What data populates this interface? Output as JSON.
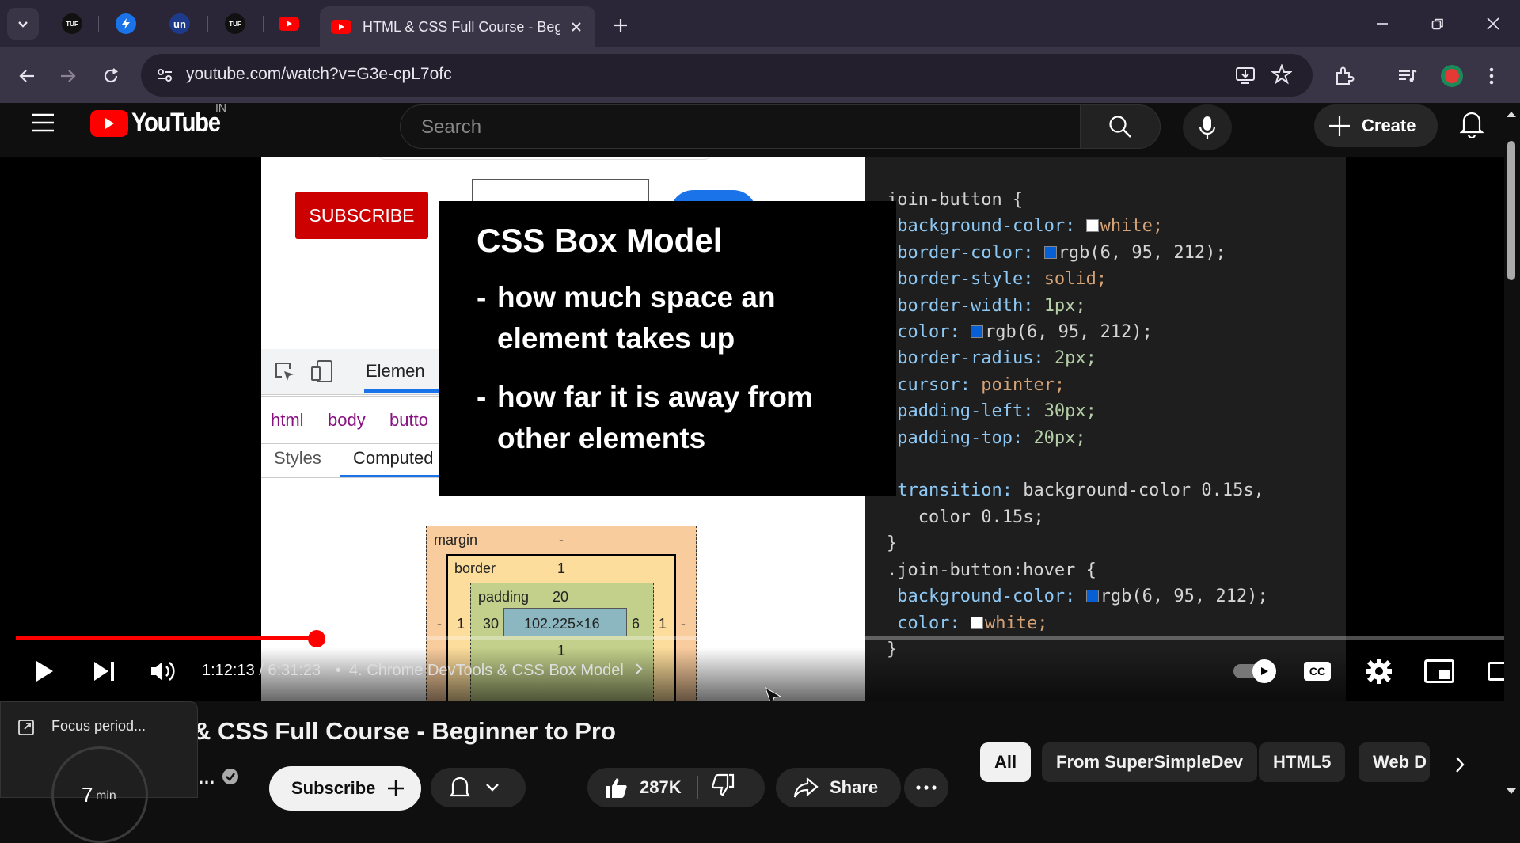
{
  "browser": {
    "tabs": [
      {
        "label": "TUF",
        "icon": "tuf-favicon"
      },
      {
        "label": "",
        "icon": "blue-bolt-favicon"
      },
      {
        "label": "un",
        "icon": "un-favicon"
      },
      {
        "label": "TUF",
        "icon": "tuf-favicon"
      },
      {
        "label": "",
        "icon": "youtube-favicon"
      }
    ],
    "active_tab_title": "HTML & CSS Full Course - Beginner to Pro",
    "url": "youtube.com/watch?v=G3e-cpL7ofc"
  },
  "youtube": {
    "logo_text": "YouTube",
    "country_code": "IN",
    "search_placeholder": "Search",
    "create_label": "Create"
  },
  "video": {
    "subscribe_in_video": "SUBSCRIBE",
    "devtools_tab_elements": "Elemen",
    "breadcrumb": [
      "html",
      "body",
      "butto"
    ],
    "styles_tab": "Styles",
    "computed_tab": "Computed",
    "overlay": {
      "title": "CSS Box Model",
      "items": [
        {
          "dash": "-",
          "text": "how much space an element takes up"
        },
        {
          "dash": "-",
          "text": "how far it is away from other elements"
        }
      ]
    },
    "code_lines": [
      {
        "indent": 0,
        "sel": "join-button {"
      },
      {
        "indent": 1,
        "prop": "background-color",
        "swatch": "#ffffff",
        "val": "white",
        "end": ";"
      },
      {
        "indent": 1,
        "prop": "border-color",
        "swatch": "#065fd4",
        "val": "rgb(6, 95, 212)",
        "end": ";"
      },
      {
        "indent": 1,
        "prop": "border-style",
        "val": "solid",
        "end": ";"
      },
      {
        "indent": 1,
        "prop": "border-width",
        "val": "1px",
        "end": ";"
      },
      {
        "indent": 1,
        "prop": "color",
        "swatch": "#065fd4",
        "val": "rgb(6, 95, 212)",
        "end": ";"
      },
      {
        "indent": 1,
        "prop": "border-radius",
        "val": "2px",
        "end": ";"
      },
      {
        "indent": 1,
        "prop": "cursor",
        "val": "pointer",
        "end": ";"
      },
      {
        "indent": 1,
        "prop": "padding-left",
        "val": "30px",
        "end": ";"
      },
      {
        "indent": 1,
        "prop": "padding-top",
        "val": "20px",
        "end": ";"
      },
      {
        "indent": 1,
        "prop": "",
        "val": "",
        "end": ""
      },
      {
        "indent": 1,
        "prop": "transition",
        "val": "background-color 0.15s,",
        "end": ""
      },
      {
        "indent": 2,
        "prop": "",
        "val": "color 0.15s;",
        "end": ""
      },
      {
        "indent": 0,
        "sel": "}"
      },
      {
        "indent": 0,
        "sel": ""
      },
      {
        "indent": 0,
        "sel": ".join-button:hover {"
      },
      {
        "indent": 1,
        "prop": "background-color",
        "swatch": "#065fd4",
        "val": "rgb(6, 95, 212)",
        "end": ";"
      },
      {
        "indent": 1,
        "prop": "color",
        "swatch": "#ffffff",
        "val": "white",
        "end": ";"
      },
      {
        "indent": 0,
        "sel": "}"
      }
    ],
    "box_model": {
      "margin_label": "margin",
      "margin_value": "-",
      "border_label": "border",
      "border_value": "1",
      "padding_label": "padding",
      "padding_top": "20",
      "padding_left": "30",
      "padding_right": "6",
      "padding_bottom": "1",
      "border_left": "1",
      "border_right": "1",
      "margin_left": "-",
      "margin_right": "-",
      "content": "102.225×16"
    },
    "current_time": "1:12:13",
    "duration": "6:31:23",
    "chapter": "4. Chrome DevTools & CSS Box Model",
    "progress_fraction": 0.2
  },
  "below": {
    "title": "& CSS Full Course - Beginner to Pro",
    "subscribe_label": "Subscribe",
    "like_count": "287K",
    "share_label": "Share",
    "chips": [
      "All",
      "From SuperSimpleDev",
      "HTML5",
      "Web D"
    ],
    "focus_label": "Focus period...",
    "focus_minutes": "7",
    "focus_unit": "min"
  },
  "colors": {
    "youtube_red": "#ff0000",
    "chrome_tab_bg": "#2b2637",
    "chrome_toolbar_bg": "#3a3447",
    "devtools_blue": "#065fd4"
  }
}
